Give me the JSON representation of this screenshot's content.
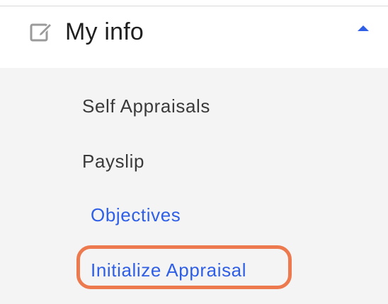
{
  "menu": {
    "title": "My info",
    "icon": "edit-icon",
    "collapse_icon": "caret-up-icon",
    "caret_color": "#2f5fe6",
    "items": [
      {
        "label": "Self Appraisals",
        "state": "default"
      },
      {
        "label": "Payslip",
        "state": "default"
      },
      {
        "label": "Objectives",
        "state": "active"
      },
      {
        "label": "Initialize Appraisal",
        "state": "active-highlighted"
      }
    ]
  },
  "colors": {
    "accent": "#2f5fe6",
    "highlight": "#ec7a4e",
    "submenu_background": "#f4f4f4",
    "text": "#3a3a3a"
  }
}
